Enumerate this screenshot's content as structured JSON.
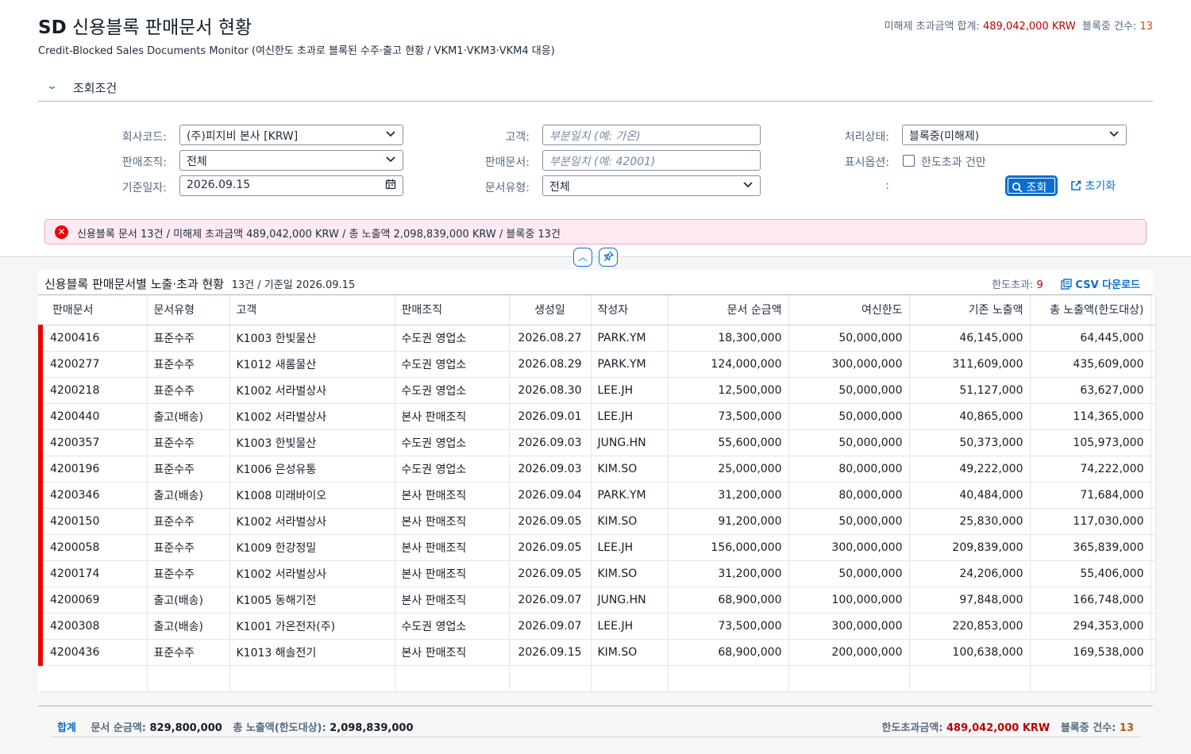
{
  "header": {
    "title_prefix": "SD",
    "title": "신용블록 판매문서 현황",
    "subtitle": "Credit-Blocked Sales Documents Monitor (여신한도 초과로 블록된 수주·출고 현황 / VKM1·VKM3·VKM4 대응)",
    "kpi_over_label": "미해제 초과금액 합계:",
    "kpi_over_value": "489,042,000 KRW",
    "kpi_blocked_label": "블록중 건수:",
    "kpi_blocked_value": "13"
  },
  "filterbar": {
    "title": "조회조건",
    "company_label": "회사코드:",
    "company_value": "(주)피지비 본사 [KRW]",
    "salesorg_label": "판매조직:",
    "salesorg_value": "전체",
    "date_label": "기준일자:",
    "date_value": "2026.09.15",
    "customer_label": "고객:",
    "customer_placeholder": "부분일치 (예: 가온)",
    "doc_label": "판매문서:",
    "doc_placeholder": "부분일치 (예: 42001)",
    "doctype_label": "문서유형:",
    "doctype_value": "전체",
    "status_label": "처리상태:",
    "status_value": "블록중(미해제)",
    "option_label": "표시옵션:",
    "option_checkbox": "한도초과 건만",
    "colon": ":",
    "go_label": "조회",
    "reset_label": "초기화"
  },
  "message": {
    "text": "신용블록 문서 13건 / 미해제 초과금액 489,042,000 KRW / 총 노출액 2,098,839,000 KRW / 블록중 13건"
  },
  "table": {
    "title": "신용블록 판매문서별 노출·초과 현황",
    "count_info": "13건 / 기준일 2026.09.15",
    "over_label": "한도초과:",
    "over_count": "9",
    "csv_label": "CSV 다운로드",
    "columns": [
      "판매문서",
      "문서유형",
      "고객",
      "판매조직",
      "생성일",
      "작성자",
      "문서 순금액",
      "여신한도",
      "기존 노출액",
      "총 노출액(한도대상)"
    ],
    "rows": [
      [
        "4200416",
        "표준수주",
        "K1003 한빛물산",
        "수도권 영업소",
        "2026.08.27",
        "PARK.YM",
        "18,300,000",
        "50,000,000",
        "46,145,000",
        "64,445,000"
      ],
      [
        "4200277",
        "표준수주",
        "K1012 새롬물산",
        "수도권 영업소",
        "2026.08.29",
        "PARK.YM",
        "124,000,000",
        "300,000,000",
        "311,609,000",
        "435,609,000"
      ],
      [
        "4200218",
        "표준수주",
        "K1002 서라벌상사",
        "수도권 영업소",
        "2026.08.30",
        "LEE.JH",
        "12,500,000",
        "50,000,000",
        "51,127,000",
        "63,627,000"
      ],
      [
        "4200440",
        "출고(배송)",
        "K1002 서라벌상사",
        "본사 판매조직",
        "2026.09.01",
        "LEE.JH",
        "73,500,000",
        "50,000,000",
        "40,865,000",
        "114,365,000"
      ],
      [
        "4200357",
        "표준수주",
        "K1003 한빛물산",
        "수도권 영업소",
        "2026.09.03",
        "JUNG.HN",
        "55,600,000",
        "50,000,000",
        "50,373,000",
        "105,973,000"
      ],
      [
        "4200196",
        "표준수주",
        "K1006 은성유통",
        "수도권 영업소",
        "2026.09.03",
        "KIM.SO",
        "25,000,000",
        "80,000,000",
        "49,222,000",
        "74,222,000"
      ],
      [
        "4200346",
        "출고(배송)",
        "K1008 미래바이오",
        "본사 판매조직",
        "2026.09.04",
        "PARK.YM",
        "31,200,000",
        "80,000,000",
        "40,484,000",
        "71,684,000"
      ],
      [
        "4200150",
        "표준수주",
        "K1002 서라벌상사",
        "본사 판매조직",
        "2026.09.05",
        "KIM.SO",
        "91,200,000",
        "50,000,000",
        "25,830,000",
        "117,030,000"
      ],
      [
        "4200058",
        "표준수주",
        "K1009 한강정밀",
        "본사 판매조직",
        "2026.09.05",
        "LEE.JH",
        "156,000,000",
        "300,000,000",
        "209,839,000",
        "365,839,000"
      ],
      [
        "4200174",
        "표준수주",
        "K1002 서라벌상사",
        "본사 판매조직",
        "2026.09.05",
        "KIM.SO",
        "31,200,000",
        "50,000,000",
        "24,206,000",
        "55,406,000"
      ],
      [
        "4200069",
        "출고(배송)",
        "K1005 동해기전",
        "본사 판매조직",
        "2026.09.07",
        "JUNG.HN",
        "68,900,000",
        "100,000,000",
        "97,848,000",
        "166,748,000"
      ],
      [
        "4200308",
        "출고(배송)",
        "K1001 가온전자(주)",
        "수도권 영업소",
        "2026.09.07",
        "LEE.JH",
        "73,500,000",
        "300,000,000",
        "220,853,000",
        "294,353,000"
      ],
      [
        "4200436",
        "표준수주",
        "K1013 해솔전기",
        "본사 판매조직",
        "2026.09.15",
        "KIM.SO",
        "68,900,000",
        "200,000,000",
        "100,638,000",
        "169,538,000"
      ]
    ]
  },
  "summary": {
    "label": "합계",
    "net_label": "문서 순금액:",
    "net_value": "829,800,000",
    "exposure_label": "총 노출액(한도대상):",
    "exposure_value": "2,098,839,000",
    "over_label": "한도초과금액:",
    "over_value": "489,042,000 KRW",
    "blocked_label": "블록중 건수:",
    "blocked_value": "13"
  }
}
